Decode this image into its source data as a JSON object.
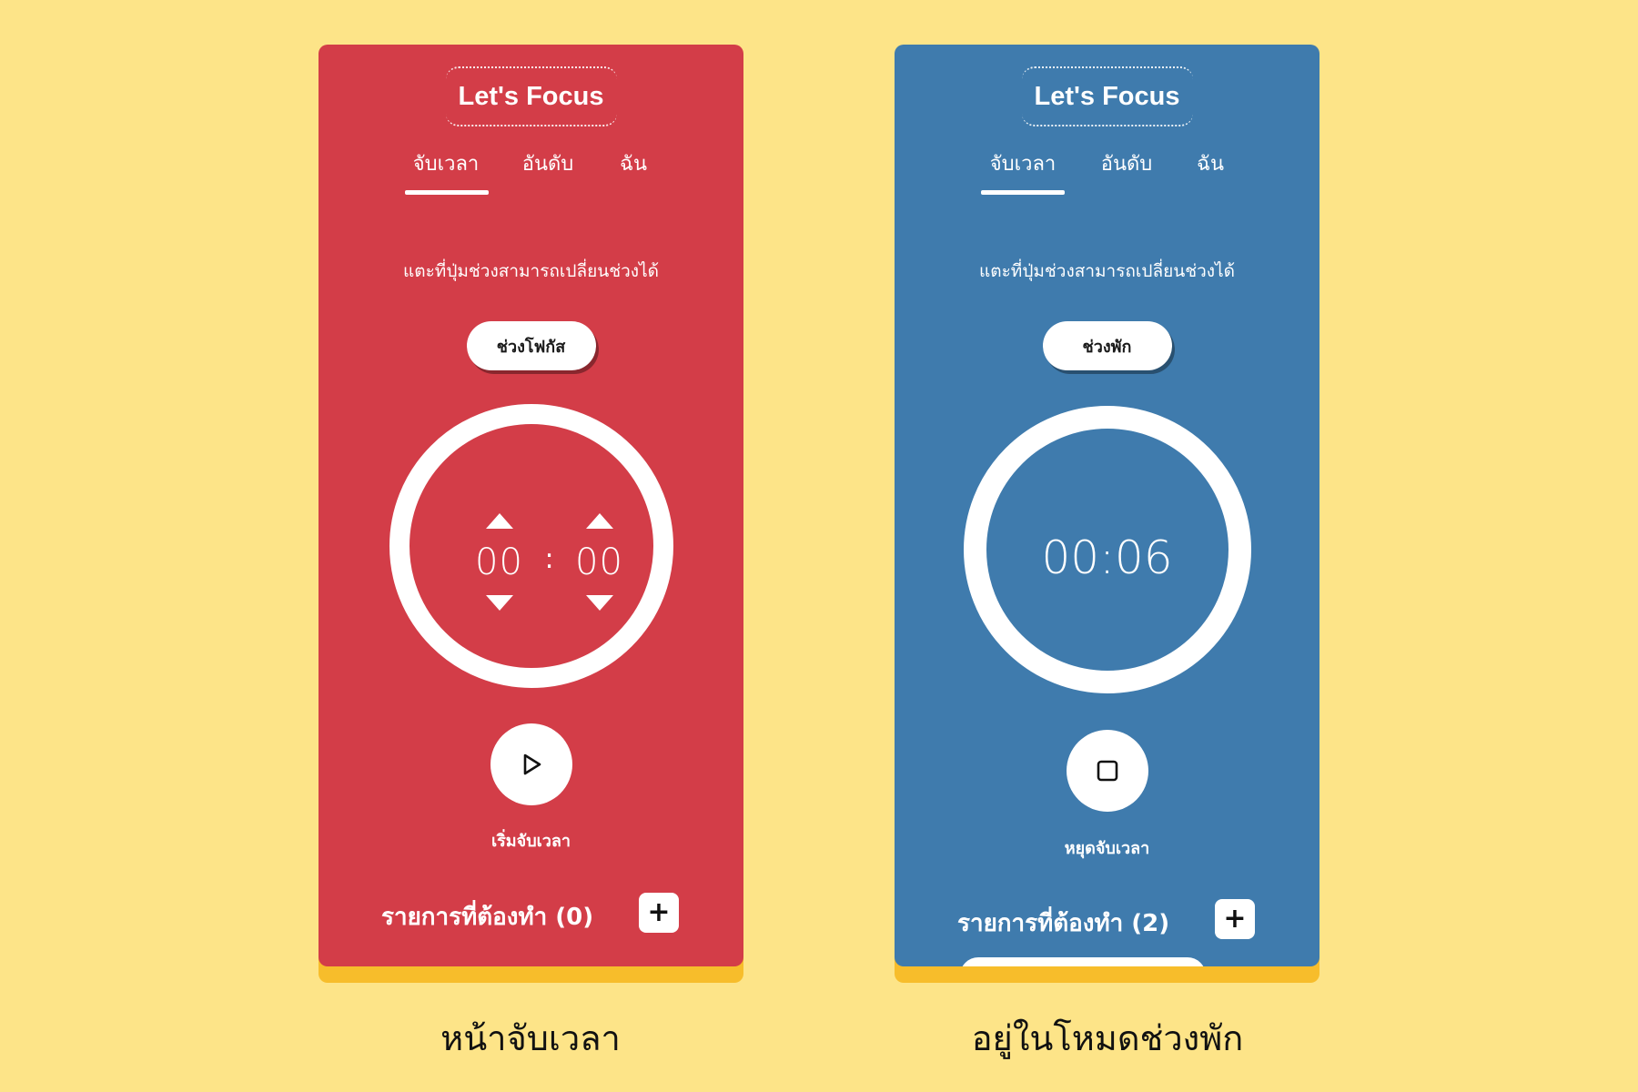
{
  "background_color": "#FDE488",
  "shadow_color": "#F7BD2B",
  "screens": [
    {
      "theme_color": "#D33D48",
      "app_title": "Let's Focus",
      "tabs": [
        {
          "label": "จับเวลา",
          "active": true
        },
        {
          "label": "อันดับ",
          "active": false
        },
        {
          "label": "ฉัน",
          "active": false
        }
      ],
      "hint": "แตะที่ปุ่มช่วงสามารถเปลี่ยนช่วงได้",
      "mode_label": "ช่วงโฟกัส",
      "timer": {
        "minutes": "00",
        "separator": ":",
        "seconds": "00"
      },
      "action_icon": "play-icon",
      "action_label": "เริ่มจับเวลา",
      "todo_label": "รายการที่ต้องทำ (0)",
      "add_icon": "plus-icon",
      "add_symbol": "+",
      "caption": "หน้าจับเวลา"
    },
    {
      "theme_color": "#3F7BAD",
      "app_title": "Let's Focus",
      "tabs": [
        {
          "label": "จับเวลา",
          "active": true
        },
        {
          "label": "อันดับ",
          "active": false
        },
        {
          "label": "ฉัน",
          "active": false
        }
      ],
      "hint": "แตะที่ปุ่มช่วงสามารถเปลี่ยนช่วงได้",
      "mode_label": "ช่วงพัก",
      "timer": {
        "display": "00:06"
      },
      "action_icon": "stop-icon",
      "action_label": "หยุดจับเวลา",
      "todo_label": "รายการที่ต้องทำ (2)",
      "add_icon": "plus-icon",
      "add_symbol": "+",
      "caption": "อยู่ในโหมดช่วงพัก"
    }
  ]
}
